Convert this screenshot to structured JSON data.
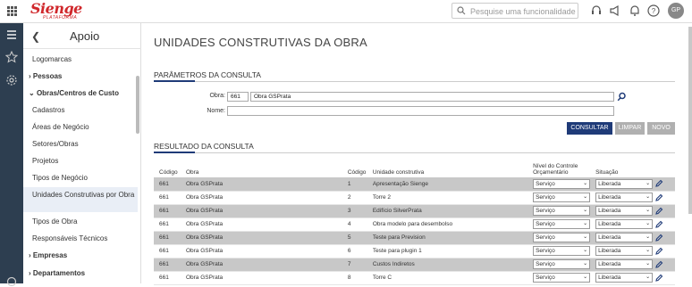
{
  "topbar": {
    "logo_text": "Sienge",
    "logo_subtitle": "PLATAFORMA",
    "search_placeholder": "Pesquise uma funcionalidade",
    "avatar_initials": "GP",
    "icons": [
      "apps-grid-icon",
      "search-icon",
      "headset-icon",
      "megaphone-icon",
      "bell-icon",
      "help-icon"
    ]
  },
  "sidebar": {
    "back_icon": "chevron-left-icon",
    "title": "Apoio",
    "items": [
      {
        "label": "Logomarcas",
        "type": "item"
      },
      {
        "label": "Pessoas",
        "type": "group",
        "prefix": ">"
      },
      {
        "label": "Obras/Centros de Custo",
        "type": "group",
        "prefix": "v"
      },
      {
        "label": "Cadastros",
        "type": "item"
      },
      {
        "label": "Áreas de Negócio",
        "type": "item"
      },
      {
        "label": "Setores/Obras",
        "type": "item"
      },
      {
        "label": "Projetos",
        "type": "item"
      },
      {
        "label": "Tipos de Negócio",
        "type": "item"
      },
      {
        "label": "Unidades Construtivas por Obra",
        "type": "item",
        "active": true
      },
      {
        "label": "Tipos de Obra",
        "type": "item"
      },
      {
        "label": "Responsáveis Técnicos",
        "type": "item"
      },
      {
        "label": "Empresas",
        "type": "group",
        "prefix": ">"
      },
      {
        "label": "Departamentos",
        "type": "group",
        "prefix": ">"
      }
    ]
  },
  "main": {
    "page_title": "UNIDADES CONSTRUTIVAS DA OBRA",
    "params_title": "PARÂMETROS DA CONSULTA",
    "obra_label": "Obra:",
    "obra_code": "661",
    "obra_name": "Obra GSPrata",
    "nome_label": "Nome:",
    "nome_value": "",
    "buttons": {
      "consultar": "CONSULTAR",
      "limpar": "LIMPAR",
      "novo": "NOVO"
    },
    "result_title": "RESULTADO DA CONSULTA",
    "columns": [
      "Código",
      "Obra",
      "Código",
      "Unidade construtiva",
      "Nível do Controle Orçamentário",
      "Situação"
    ],
    "rows": [
      {
        "obra_code": "661",
        "obra": "Obra GSPrata",
        "code": "1",
        "unit": "Apresentação Sienge",
        "nivel": "Serviço",
        "situacao": "Liberada"
      },
      {
        "obra_code": "661",
        "obra": "Obra GSPrata",
        "code": "2",
        "unit": "Torre 2",
        "nivel": "Serviço",
        "situacao": "Liberada"
      },
      {
        "obra_code": "661",
        "obra": "Obra GSPrata",
        "code": "3",
        "unit": "Edifício SilverPrata",
        "nivel": "Serviço",
        "situacao": "Liberada"
      },
      {
        "obra_code": "661",
        "obra": "Obra GSPrata",
        "code": "4",
        "unit": "Obra modelo para desembolso",
        "nivel": "Serviço",
        "situacao": "Liberada"
      },
      {
        "obra_code": "661",
        "obra": "Obra GSPrata",
        "code": "5",
        "unit": "Teste para Prevision",
        "nivel": "Serviço",
        "situacao": "Liberada"
      },
      {
        "obra_code": "661",
        "obra": "Obra GSPrata",
        "code": "6",
        "unit": "Teste para plugin 1",
        "nivel": "Serviço",
        "situacao": "Liberada"
      },
      {
        "obra_code": "661",
        "obra": "Obra GSPrata",
        "code": "7",
        "unit": "Custos Indiretos",
        "nivel": "Serviço",
        "situacao": "Liberada"
      },
      {
        "obra_code": "661",
        "obra": "Obra GSPrata",
        "code": "8",
        "unit": "Torre C",
        "nivel": "Serviço",
        "situacao": "Liberada"
      }
    ]
  },
  "colors": {
    "accent": "#1f3b78",
    "brand": "#d0282c",
    "rail": "#2d3e50",
    "row_shade": "#c8c8c8"
  }
}
